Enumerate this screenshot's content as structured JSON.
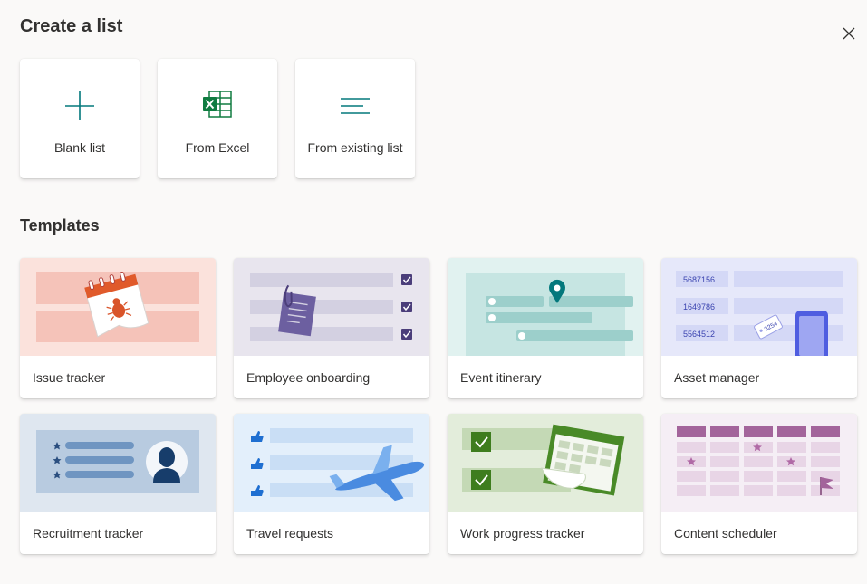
{
  "dialog": {
    "title": "Create a list",
    "close_icon": "close-icon"
  },
  "create_options": [
    {
      "label": "Blank list",
      "icon": "plus-icon"
    },
    {
      "label": "From Excel",
      "icon": "excel-icon"
    },
    {
      "label": "From existing list",
      "icon": "list-lines-icon"
    }
  ],
  "templates_section": {
    "title": "Templates",
    "items": [
      {
        "label": "Issue tracker",
        "icon": "bug-calendar-illustration"
      },
      {
        "label": "Employee onboarding",
        "icon": "clipboard-checklist-illustration"
      },
      {
        "label": "Event itinerary",
        "icon": "map-pin-timeline-illustration"
      },
      {
        "label": "Asset manager",
        "icon": "asset-tag-phone-illustration"
      },
      {
        "label": "Recruitment tracker",
        "icon": "candidate-profile-illustration"
      },
      {
        "label": "Travel requests",
        "icon": "airplane-illustration"
      },
      {
        "label": "Work progress tracker",
        "icon": "checked-calendar-illustration"
      },
      {
        "label": "Content scheduler",
        "icon": "schedule-grid-illustration"
      }
    ],
    "asset_numbers": [
      "5687156",
      "1649786",
      "5564512"
    ],
    "asset_tag_number": "3254"
  },
  "colors": {
    "brand_teal": "#03787c",
    "excel_green": "#107c41",
    "background": "#faf9f8"
  }
}
